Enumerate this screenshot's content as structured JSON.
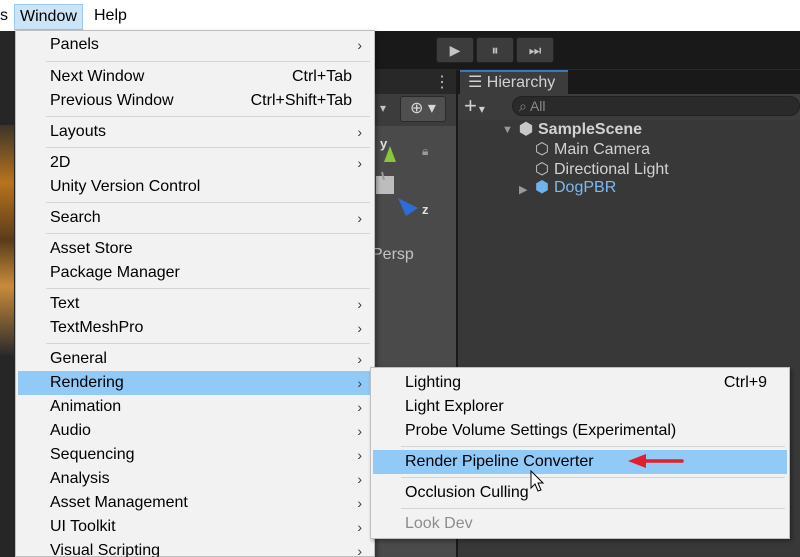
{
  "menubar": {
    "partial_left": "s",
    "window": "Window",
    "help": "Help"
  },
  "toolbar": {
    "play": "▶",
    "pause": "⏸",
    "step": "⏭"
  },
  "scene": {
    "axis_y": "y",
    "axis_z": "z",
    "persp": "Persp"
  },
  "hierarchy": {
    "tab": "Hierarchy",
    "add": "+",
    "add_caret": "▾",
    "search_placeholder": "All",
    "items": [
      {
        "label": "SampleScene",
        "kind": "scene"
      },
      {
        "label": "Main Camera",
        "kind": "object"
      },
      {
        "label": "Directional Light",
        "kind": "object"
      },
      {
        "label": "DogPBR",
        "kind": "prefab"
      }
    ]
  },
  "window_menu": {
    "items": [
      {
        "label": "Panels",
        "submenu": true
      },
      {
        "label": "Next Window",
        "shortcut": "Ctrl+Tab"
      },
      {
        "label": "Previous Window",
        "shortcut": "Ctrl+Shift+Tab"
      },
      {
        "label": "Layouts",
        "submenu": true
      },
      {
        "label": "2D",
        "submenu": true
      },
      {
        "label": "Unity Version Control"
      },
      {
        "label": "Search",
        "submenu": true
      },
      {
        "label": "Asset Store"
      },
      {
        "label": "Package Manager"
      },
      {
        "label": "Text",
        "submenu": true
      },
      {
        "label": "TextMeshPro",
        "submenu": true
      },
      {
        "label": "General",
        "submenu": true
      },
      {
        "label": "Rendering",
        "submenu": true,
        "highlighted": true
      },
      {
        "label": "Animation",
        "submenu": true
      },
      {
        "label": "Audio",
        "submenu": true
      },
      {
        "label": "Sequencing",
        "submenu": true
      },
      {
        "label": "Analysis",
        "submenu": true
      },
      {
        "label": "Asset Management",
        "submenu": true
      },
      {
        "label": "UI Toolkit",
        "submenu": true
      },
      {
        "label": "Visual Scripting",
        "submenu": true
      }
    ]
  },
  "rendering_menu": {
    "items": [
      {
        "label": "Lighting",
        "shortcut": "Ctrl+9"
      },
      {
        "label": "Light Explorer"
      },
      {
        "label": "Probe Volume Settings (Experimental)"
      },
      {
        "label": "Render Pipeline Converter",
        "highlighted": true
      },
      {
        "label": "Occlusion Culling"
      },
      {
        "label": "Look Dev",
        "disabled": true
      }
    ]
  },
  "colors": {
    "highlight": "#91c9f7",
    "menu_bg": "#f2f2f2",
    "arrow": "#e0202a",
    "prefab_text": "#7db9f3"
  }
}
